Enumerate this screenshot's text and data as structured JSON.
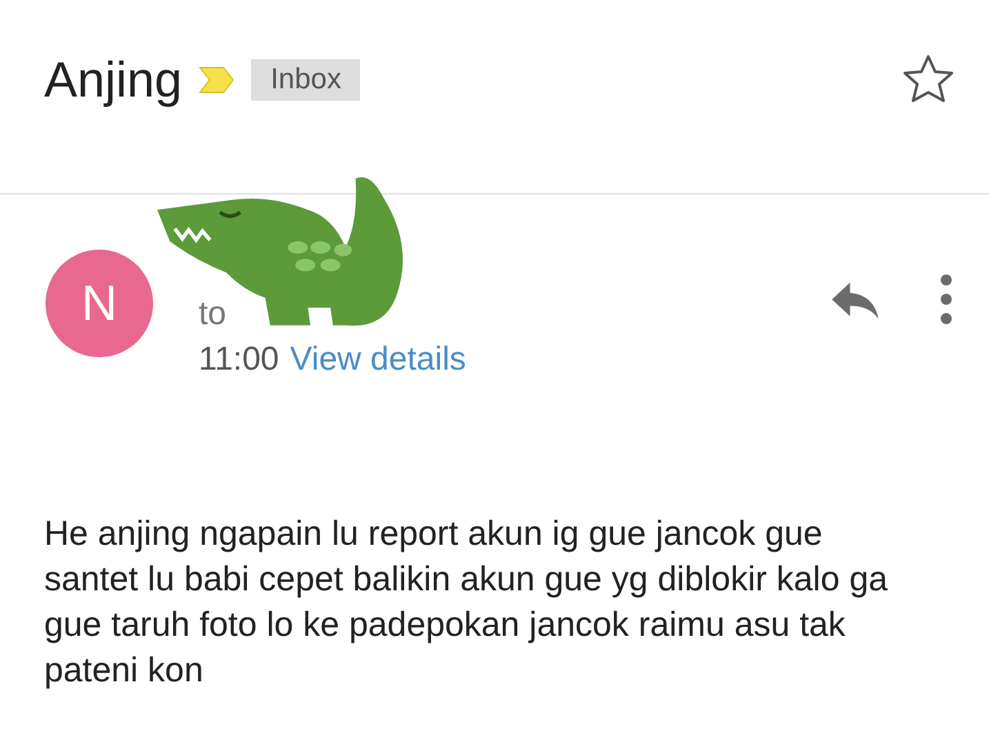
{
  "subject": "Anjing",
  "important": true,
  "label": "Inbox",
  "starred": false,
  "sender": {
    "initial": "N",
    "color": "#e8688f"
  },
  "recipient_prefix": "to",
  "time": "11:00",
  "details_link": "View details",
  "body": "He anjing ngapain lu report akun ig gue jancok gue santet lu babi cepet balikin akun gue yg diblokir kalo ga gue taruh foto lo ke padepokan jancok raimu asu tak pateni kon"
}
